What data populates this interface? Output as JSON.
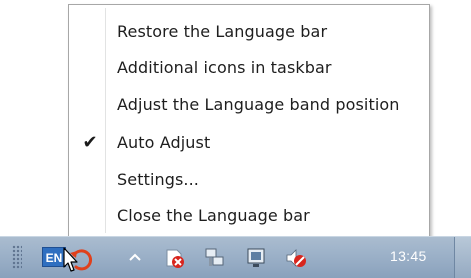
{
  "menu": {
    "items": [
      {
        "label": "Restore the Language bar",
        "checked": false
      },
      {
        "label": "Additional icons in taskbar",
        "checked": false
      },
      {
        "label": "Adjust the Language band position",
        "checked": false
      },
      {
        "label": "Auto Adjust",
        "checked": true
      },
      {
        "label": "Settings...",
        "checked": false
      },
      {
        "label": "Close the Language bar",
        "checked": false
      }
    ],
    "check_glyph": "✔"
  },
  "taskbar": {
    "language_indicator": "EN",
    "clock": "13:45",
    "icons": [
      "grip-icon",
      "language-icon",
      "restore-arrow-icon",
      "pointer-cursor-icon",
      "show-hidden-icons-icon",
      "action-center-icon",
      "network-icon",
      "display-icon",
      "volume-muted-icon"
    ],
    "background_color": "#9db2c9"
  }
}
